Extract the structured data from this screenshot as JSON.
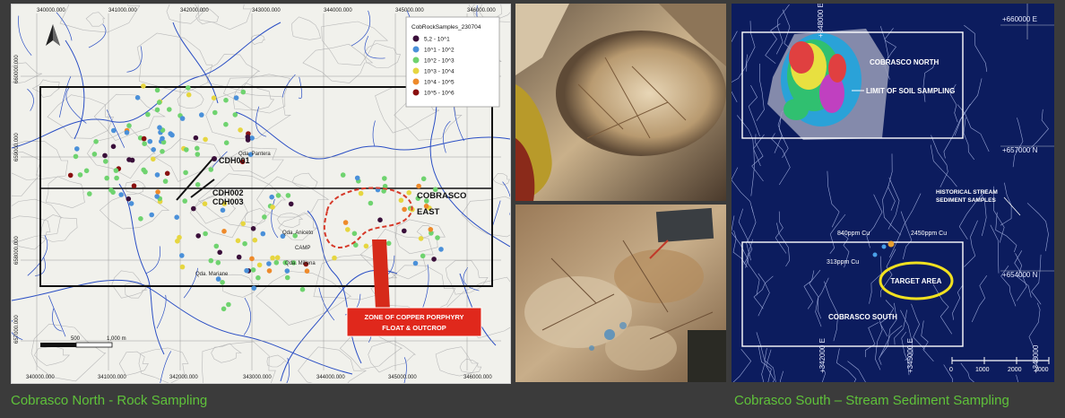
{
  "left_map": {
    "top_ticks": [
      "340000.000",
      "341000.000",
      "342000.000",
      "343000.000",
      "344000.000",
      "345000.000",
      "346000.000"
    ],
    "bottom_ticks": [
      "340000.000",
      "341000.000",
      "342000.000",
      "343000.000",
      "344000.000",
      "345000.000",
      "346000.000"
    ],
    "left_ticks": [
      "660000.000",
      "659000.000",
      "658000.000",
      "657000.000"
    ],
    "legend_title": "CobRockSamples_230704",
    "legend": [
      {
        "label": "5,2 - 10^1",
        "color": "#3a0f3a"
      },
      {
        "label": "10^1 - 10^2",
        "color": "#4a90d9"
      },
      {
        "label": "10^2 - 10^3",
        "color": "#6fd36f"
      },
      {
        "label": "10^3 - 10^4",
        "color": "#e6d640"
      },
      {
        "label": "10^4 - 10^5",
        "color": "#ee8a2a"
      },
      {
        "label": "10^5 - 10^6",
        "color": "#8a1010"
      }
    ],
    "drillholes": [
      "CDH001",
      "CDH002",
      "CDH003"
    ],
    "places": [
      "Qda. Pantera",
      "Qda. Aniceto",
      "CAMP",
      "Qda. Millena",
      "Qda. Mariane"
    ],
    "cobrasco_label_1": "COBRASCO",
    "cobrasco_label_2": "EAST",
    "callout_line1": "ZONE OF COPPER PORPHYRY",
    "callout_line2": "FLOAT & OUTCROP",
    "scalebar_0": "500",
    "scalebar_1": "1,000 m"
  },
  "right_map": {
    "east_top": "+660000 E",
    "north_1": "+657000 N",
    "north_2": "+654000 N",
    "vertical_top": "+348000 E",
    "vertical_bottom_1": "+342000 E",
    "vertical_bottom_2": "+345000 E",
    "vertical_bottom_3": "+348000",
    "cobrasco_north": "COBRASCO NORTH",
    "limit_soil": "LIMIT OF SOIL SAMPLING",
    "historical_1": "HISTORICAL STREAM",
    "historical_2": "SEDIMENT SAMPLES",
    "sample_840": "840ppm Cu",
    "sample_2450": "2450ppm Cu",
    "sample_313": "313ppm Cu",
    "target_area": "TARGET AREA",
    "cobrasco_south": "COBRASCO SOUTH",
    "scale_labels": [
      "0",
      "1000",
      "2000",
      "3000"
    ]
  },
  "captions": {
    "left": "Cobrasco North - Rock Sampling",
    "right": "Cobrasco South – Stream Sediment Sampling"
  }
}
